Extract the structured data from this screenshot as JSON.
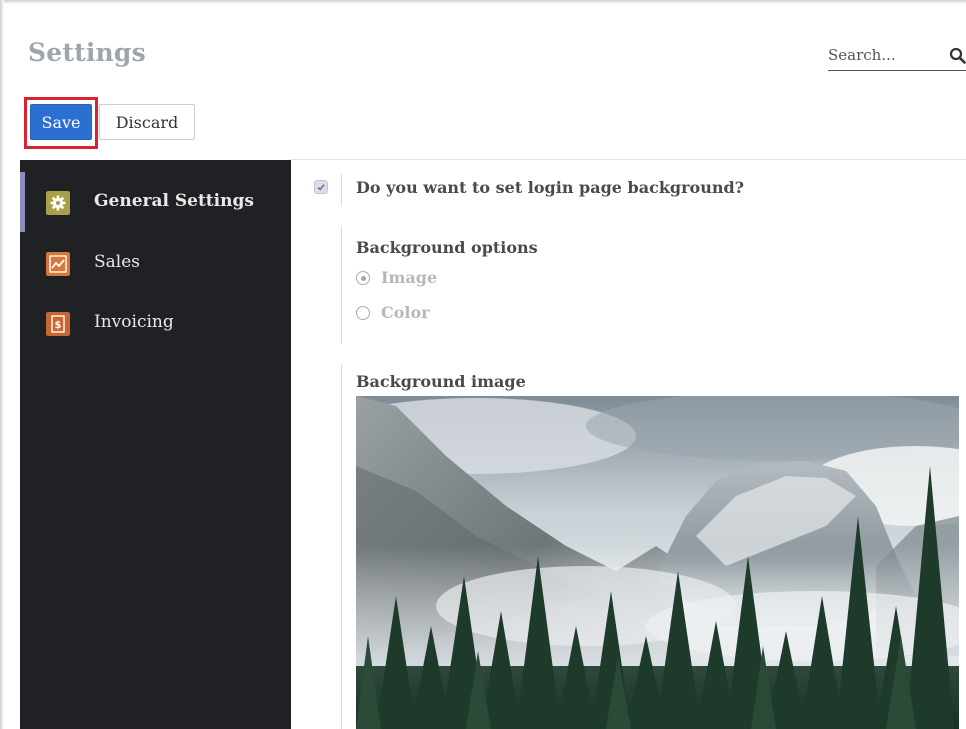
{
  "header": {
    "title": "Settings",
    "search_placeholder": "Search..."
  },
  "toolbar": {
    "save_label": "Save",
    "discard_label": "Discard"
  },
  "sidebar": {
    "items": [
      {
        "label": "General Settings",
        "icon": "gear-icon",
        "icon_color": "#a8a046",
        "active": true
      },
      {
        "label": "Sales",
        "icon": "trending-chart-icon",
        "icon_color": "#d9773a",
        "active": false
      },
      {
        "label": "Invoicing",
        "icon": "invoice-dollar-icon",
        "icon_color": "#c8662e",
        "active": false
      }
    ]
  },
  "content": {
    "login_background_question": "Do you want to set login page background?",
    "login_background_checked": true,
    "background_options_title": "Background options",
    "options": [
      {
        "label": "Image",
        "selected": true
      },
      {
        "label": "Color",
        "selected": false
      }
    ],
    "background_image_title": "Background image",
    "background_image_icon": "mountain-forest-photo"
  },
  "colors": {
    "primary": "#2b6fd1",
    "highlight": "#d9232e",
    "sidebar_bg": "#1f2125"
  }
}
